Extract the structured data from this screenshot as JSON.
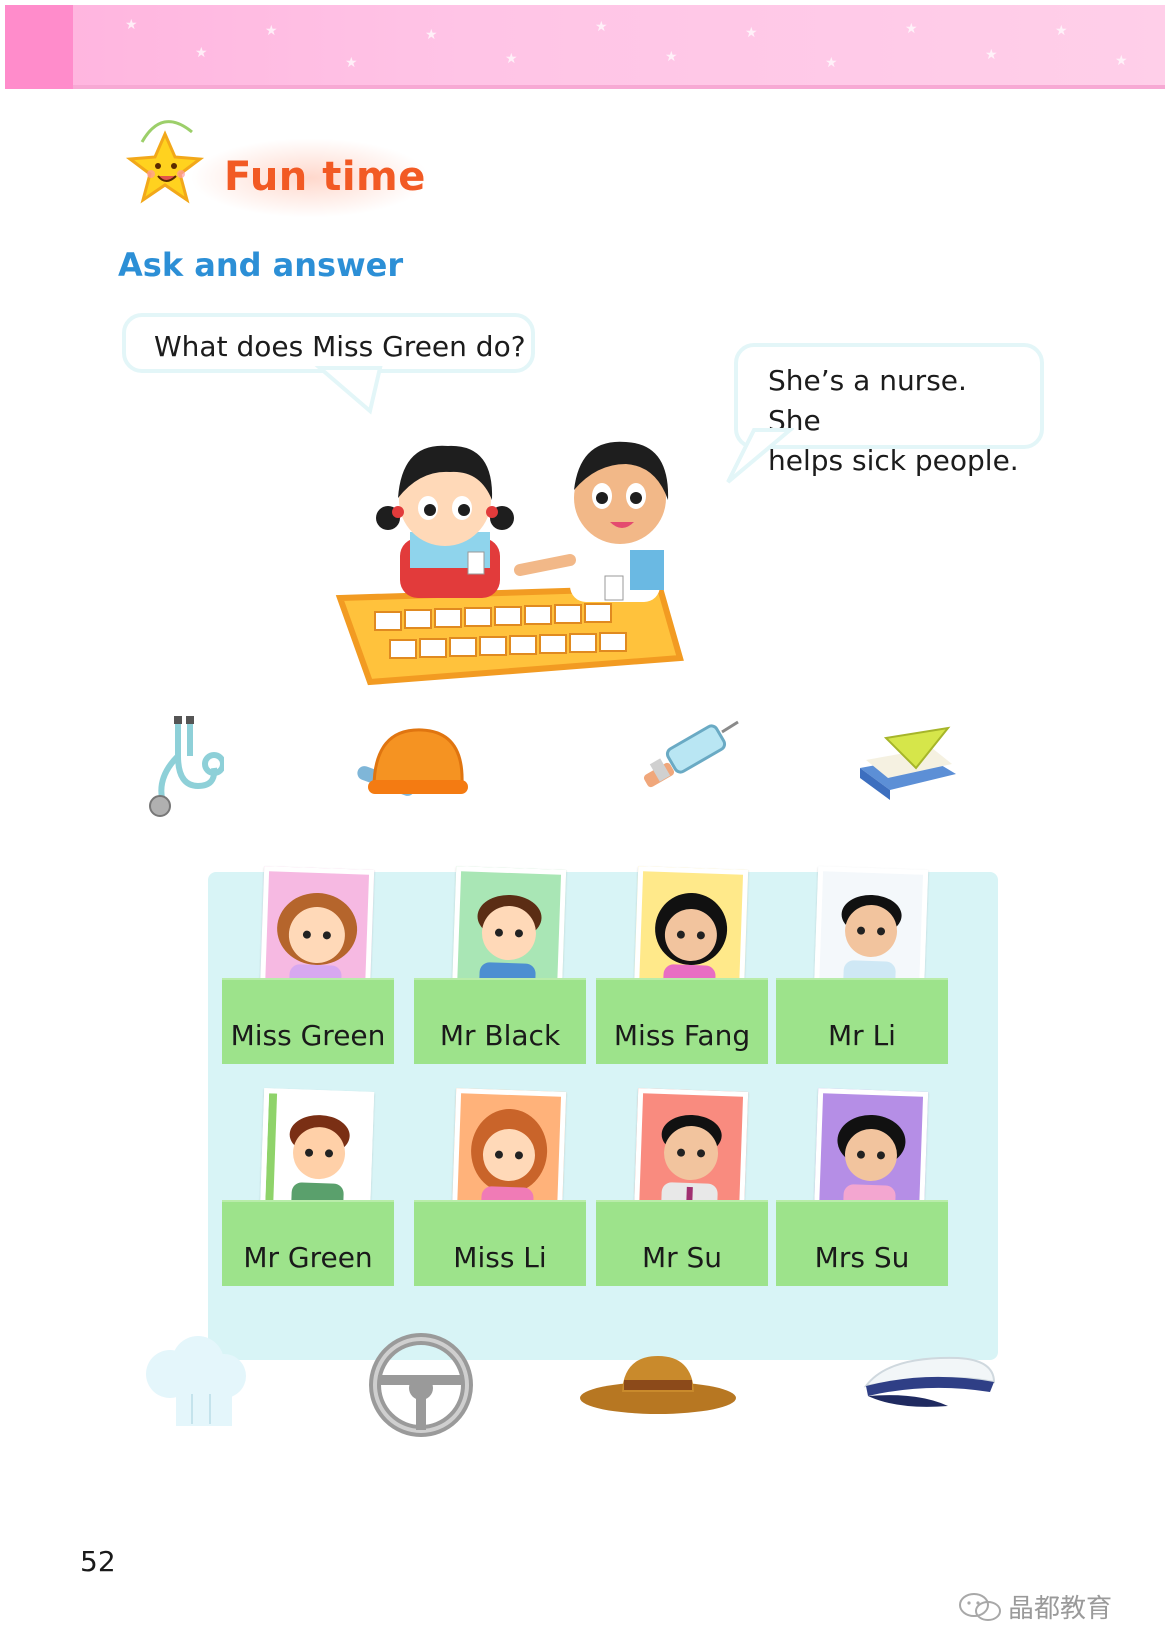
{
  "header": {
    "section_label": "Fun time",
    "activity_title": "Ask and answer"
  },
  "dialogue": {
    "question": "What does Miss Green do?",
    "answer_line1": "She’s a nurse. She",
    "answer_line2": "helps sick people."
  },
  "tools_top": [
    "stethoscope-icon",
    "hard-hat-wrench-icon",
    "syringe-icon",
    "books-ruler-icon"
  ],
  "cards": [
    {
      "name": "Miss Green",
      "photo_bg": "#f6b9e2"
    },
    {
      "name": "Mr Black",
      "photo_bg": "#a9e6b5"
    },
    {
      "name": "Miss Fang",
      "photo_bg": "#ffe98a"
    },
    {
      "name": "Mr Li",
      "photo_bg": "#f4f8fb"
    },
    {
      "name": "Mr Green",
      "photo_bg": "#ffffff"
    },
    {
      "name": "Miss Li",
      "photo_bg": "#ffb27a"
    },
    {
      "name": "Mr Su",
      "photo_bg": "#f98b7f"
    },
    {
      "name": "Mrs Su",
      "photo_bg": "#b58ee6"
    }
  ],
  "tools_bottom": [
    "chef-hat-icon",
    "steering-wheel-icon",
    "straw-hat-icon",
    "captain-cap-icon"
  ],
  "footer": {
    "page_number": "52",
    "watermark": "晶都教育"
  },
  "colors": {
    "banner": "#ffc4e6",
    "title_orange": "#f25a24",
    "subtitle_blue": "#2c8fd6",
    "panel": "#d8f4f6",
    "label_green": "#9de38b"
  }
}
